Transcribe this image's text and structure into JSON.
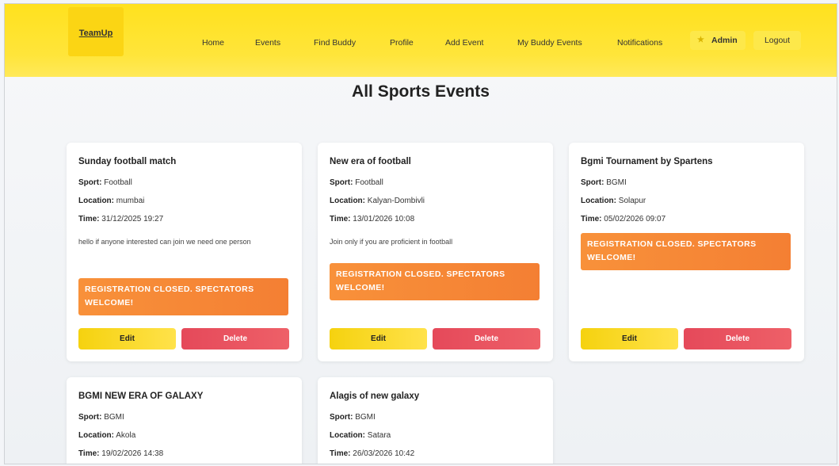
{
  "nav": {
    "logo": "TeamUp",
    "links": [
      "Home",
      "Events",
      "Find Buddy",
      "Profile",
      "Add Event",
      "My Buddy Events",
      "Notifications"
    ],
    "admin_label": "Admin",
    "admin_icon": "star-icon",
    "logout_label": "Logout"
  },
  "page": {
    "title": "All Sports Events"
  },
  "labels": {
    "sport": "Sport:",
    "location": "Location:",
    "time": "Time:",
    "edit": "Edit",
    "delete": "Delete"
  },
  "events": [
    {
      "title": "Sunday football match",
      "sport": "Football",
      "location": "mumbai",
      "time": "31/12/2025 19:27",
      "description": "hello if anyone interested can join we need one person",
      "status": "REGISTRATION CLOSED. SPECTATORS WELCOME!"
    },
    {
      "title": "New era of football",
      "sport": "Football",
      "location": "Kalyan-Dombivli",
      "time": "13/01/2026 10:08",
      "description": "Join only if you are proficient in football",
      "status": "REGISTRATION CLOSED. SPECTATORS WELCOME!"
    },
    {
      "title": "Bgmi Tournament by Spartens",
      "sport": "BGMI",
      "location": "Solapur",
      "time": "05/02/2026 09:07",
      "description": "",
      "status": "REGISTRATION CLOSED. SPECTATORS WELCOME!"
    },
    {
      "title": "BGMI NEW ERA OF GALAXY",
      "sport": "BGMI",
      "location": "Akola",
      "time": "19/02/2026 14:38"
    },
    {
      "title": "Alagis of new galaxy",
      "sport": "BGMI",
      "location": "Satara",
      "time": "26/03/2026 10:42"
    }
  ],
  "colors": {
    "nav_bg": "#ffe11e",
    "closed_banner": "#f8913a",
    "edit_button": "#f5d20f",
    "delete_button": "#e5495a"
  }
}
